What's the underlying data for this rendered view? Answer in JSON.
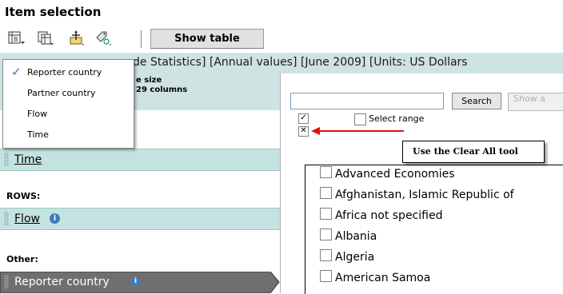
{
  "title": "Item selection",
  "toolbar": {
    "icons": [
      "pivot-layout-icon",
      "layout-icon",
      "move-dimension-icon",
      "tag-settings-icon"
    ],
    "show_table_label": "Show table"
  },
  "breadcrumb": "de Statistics] [Annual values] [June 2009] [Units: US Dollars",
  "left_panel": {
    "size_label": "e size",
    "size_value": "29 columns",
    "time_label": "Time",
    "rows_label": "ROWS:",
    "flow_label": "Flow",
    "other_label": "Other:",
    "reporter_label": "Reporter country",
    "info_glyph": "i"
  },
  "menu": {
    "items": [
      {
        "label": "Reporter country",
        "checked": true
      },
      {
        "label": "Partner country",
        "checked": false
      },
      {
        "label": "Flow",
        "checked": false
      },
      {
        "label": "Time",
        "checked": false
      }
    ],
    "check_glyph": "✓"
  },
  "right_panel": {
    "search_value": "",
    "search_button": "Search",
    "show_button": "Show a",
    "select_range_label": "Select range",
    "select_all_glyph": "✓",
    "clear_all_glyph": "✕",
    "callout": "Use the Clear All tool",
    "items": [
      "Advanced Economies",
      "Afghanistan, Islamic Republic of",
      "Africa not specified",
      "Albania",
      "Algeria",
      "American Samoa"
    ]
  },
  "colors": {
    "strip": "#cfe3e3",
    "dimension_row": "#c4e3e0",
    "reporter_row": "#6f6f6f",
    "arrow": "#e01010",
    "info_icon": "#3b7bbf"
  }
}
